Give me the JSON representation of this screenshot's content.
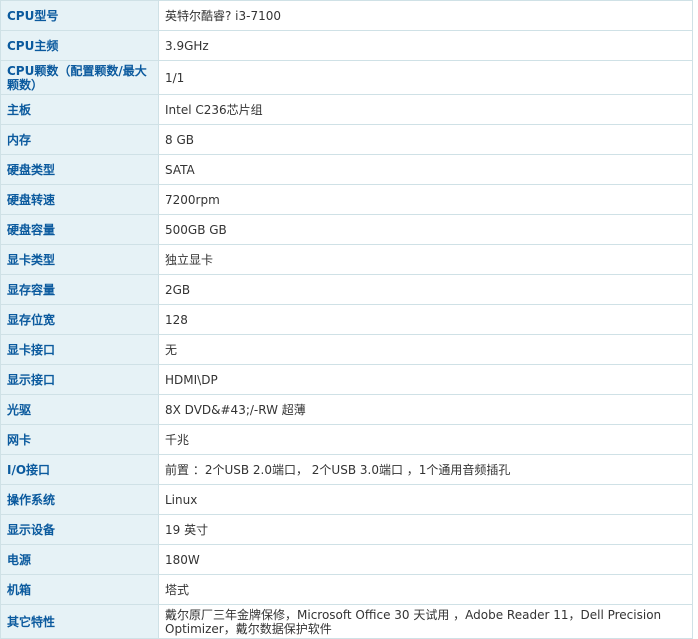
{
  "specs": [
    {
      "label": "CPU型号",
      "value": "英特尔酷睿? i3-7100"
    },
    {
      "label": "CPU主频",
      "value": "3.9GHz"
    },
    {
      "label": "CPU颗数（配置颗数/最大颗数）",
      "value": "1/1"
    },
    {
      "label": "主板",
      "value": "Intel C236芯片组"
    },
    {
      "label": "内存",
      "value": "8  GB"
    },
    {
      "label": "硬盘类型",
      "value": "SATA"
    },
    {
      "label": "硬盘转速",
      "value": "7200rpm"
    },
    {
      "label": "硬盘容量",
      "value": "500GB   GB"
    },
    {
      "label": "显卡类型",
      "value": "独立显卡"
    },
    {
      "label": "显存容量",
      "value": "2GB"
    },
    {
      "label": "显存位宽",
      "value": "128"
    },
    {
      "label": "显卡接口",
      "value": "无"
    },
    {
      "label": "显示接口",
      "value": "HDMI\\DP"
    },
    {
      "label": "光驱",
      "value": "8X DVD&#43;/-RW 超薄"
    },
    {
      "label": "网卡",
      "value": "千兆"
    },
    {
      "label": "I/O接口",
      "value": "前置 ：2个USB 2.0端口， 2个USB 3.0端口 ，1个通用音频插孔"
    },
    {
      "label": "操作系统",
      "value": "Linux"
    },
    {
      "label": "显示设备",
      "value": "19  英寸"
    },
    {
      "label": "电源",
      "value": "180W"
    },
    {
      "label": "机箱",
      "value": "塔式"
    },
    {
      "label": "其它特性",
      "value": "戴尔原厂三年金牌保修，Microsoft Office 30 天试用 ，Adobe Reader 11，Dell Precision Optimizer，戴尔数据保护软件"
    }
  ]
}
